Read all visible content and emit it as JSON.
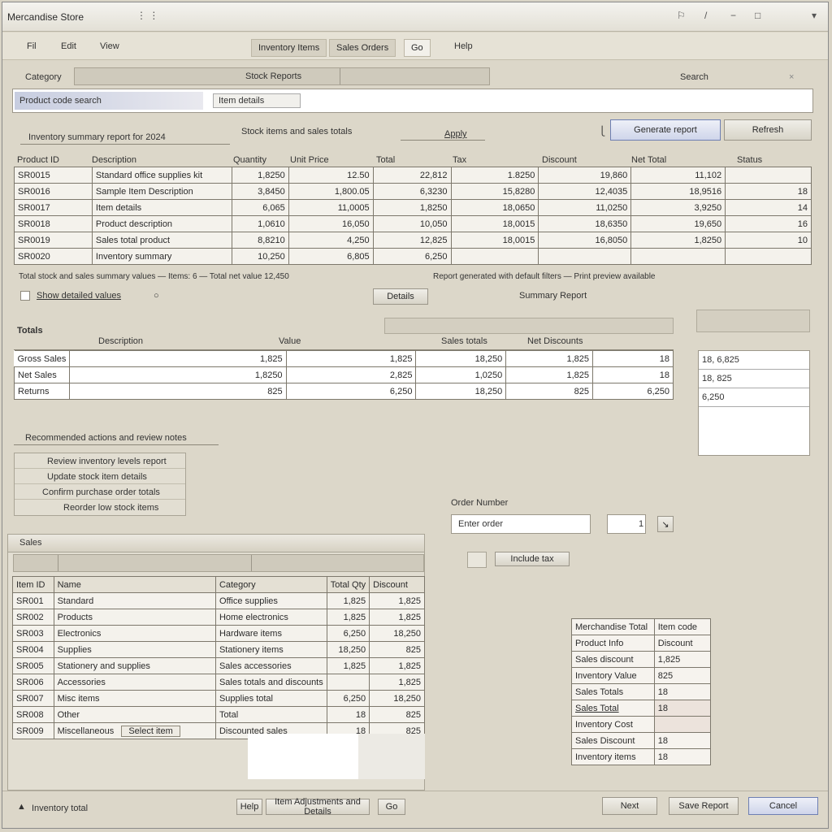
{
  "window": {
    "title": "Mercandise Store",
    "title_icons": [
      "minimize-icon",
      "restore-icon",
      "close-icon",
      "pin-icon",
      "dropdown-icon"
    ]
  },
  "menu": {
    "items": [
      "Fil",
      "Edit",
      "View"
    ],
    "tabs": [
      "Inventory Items",
      "Sales Orders",
      "Go",
      "Help"
    ]
  },
  "top": {
    "filter_label": "Category",
    "filter_value": "Stock Reports",
    "right_label": "Search",
    "search_prefix": "Product code search",
    "search_chip": "Item details",
    "search_value": ""
  },
  "toolbar": {
    "left_label": "Inventory summary report for 2024",
    "mid_label": "Stock items and sales totals",
    "mid_link": "Apply",
    "button1": "Generate report",
    "button2": "Refresh"
  },
  "main_table": {
    "headers": [
      "Product ID",
      "Description",
      "Quantity",
      "Unit Price",
      "Total",
      "Tax",
      "Discount",
      "Net Total",
      "Status"
    ],
    "rows": [
      [
        "SR0015",
        "Standard office supplies kit",
        "1,8250",
        "12.50",
        "22,812",
        "1.8250",
        "19,860",
        "11,102",
        ""
      ],
      [
        "SR0016",
        "Sample Item Description",
        "3,8450",
        "1,800.05",
        "6,3230",
        "15,8280",
        "12,4035",
        "18,9516",
        "18"
      ],
      [
        "SR0017",
        "Item details",
        "6,065",
        "11,0005",
        "1,8250",
        "18,0650",
        "11,0250",
        "3,9250",
        "14"
      ],
      [
        "SR0018",
        "Product description",
        "1,0610",
        "16,050",
        "10,050",
        "18,0015",
        "18,6350",
        "19,650",
        "16"
      ],
      [
        "SR0019",
        "Sales total product",
        "8,8210",
        "4,250",
        "12,825",
        "18,0015",
        "16,8050",
        "1,8250",
        "10"
      ],
      [
        "SR0020",
        "Inventory summary",
        "10,250",
        "6,805",
        "6,250",
        "",
        "",
        "",
        ""
      ]
    ]
  },
  "summary_line": {
    "text": "Total stock and sales summary values — Items: 6 — Total net value 12,450",
    "right_text": "Report generated with default filters — Print preview available"
  },
  "sub_controls": {
    "checkbox_label": "Show detailed values",
    "mid_button": "Details",
    "right_label": "Summary Report"
  },
  "second_table": {
    "title": "Totals",
    "headers": [
      "Description",
      "Value",
      "",
      "Sales totals",
      "Net Discounts",
      ""
    ],
    "rows": [
      [
        "Gross Sales",
        "1,825",
        "1,825",
        "18,250",
        "1,825",
        "18"
      ],
      [
        "Net Sales",
        "1,8250",
        "2,825",
        "1,0250",
        "1,825",
        "18"
      ],
      [
        "Returns",
        "825",
        "6,250",
        "18,250",
        "825",
        "6,250"
      ]
    ],
    "side_rows": [
      "18, 6,825",
      "18, 825",
      "6,250"
    ]
  },
  "left_list": {
    "title": "Recommended actions and review notes",
    "items": [
      "Review inventory levels report",
      "Update stock item details",
      "Confirm purchase order totals",
      "Reorder low stock items"
    ]
  },
  "right_form": {
    "label": "Order Number",
    "field_value": "Enter order",
    "small_value": "1",
    "go_icon": "arrow-icon",
    "checkbox_label": "Include tax"
  },
  "bottom_table": {
    "title": "Sales",
    "headers": [
      "Item ID",
      "Name",
      "Category",
      "Total Qty",
      "Discount"
    ],
    "rows": [
      [
        "SR001",
        "Standard",
        "Office supplies",
        "1,825",
        "1,825"
      ],
      [
        "SR002",
        "Products",
        "Home electronics",
        "1,825",
        "1,825"
      ],
      [
        "SR003",
        "Electronics",
        "Hardware items",
        "6,250",
        "18,250"
      ],
      [
        "SR004",
        "Supplies",
        "Stationery items",
        "18,250",
        "825"
      ],
      [
        "SR005",
        "Stationery and supplies",
        "Sales accessories",
        "1,825",
        "1,825"
      ],
      [
        "SR006",
        "Accessories",
        "Sales totals and discounts",
        "",
        "1,825"
      ],
      [
        "SR007",
        "Misc items",
        "Supplies total",
        "6,250",
        "18,250"
      ],
      [
        "SR008",
        "Other",
        "Total",
        "18",
        "825"
      ],
      [
        "SR009",
        "Miscellaneous",
        "Discounted sales",
        "18",
        "825"
      ]
    ],
    "row_button": "Select item"
  },
  "side_table": {
    "rows": [
      [
        "Merchandise Total",
        "Item code"
      ],
      [
        "Product Info",
        "Discount"
      ],
      [
        "Sales discount",
        "1,825"
      ],
      [
        "Inventory Value",
        "825"
      ],
      [
        "Sales Totals",
        "18"
      ],
      [
        "Sales Total",
        "18"
      ],
      [
        "Inventory Cost",
        ""
      ],
      [
        "Sales Discount",
        "18"
      ],
      [
        "Inventory items",
        "18"
      ]
    ]
  },
  "footer": {
    "status": "Inventory total",
    "center_left": "Help",
    "center_text": "Item Adjustments and Details",
    "center_right": "Go",
    "btn_a": "Next",
    "btn_b": "Save Report",
    "btn_c": "Cancel"
  }
}
